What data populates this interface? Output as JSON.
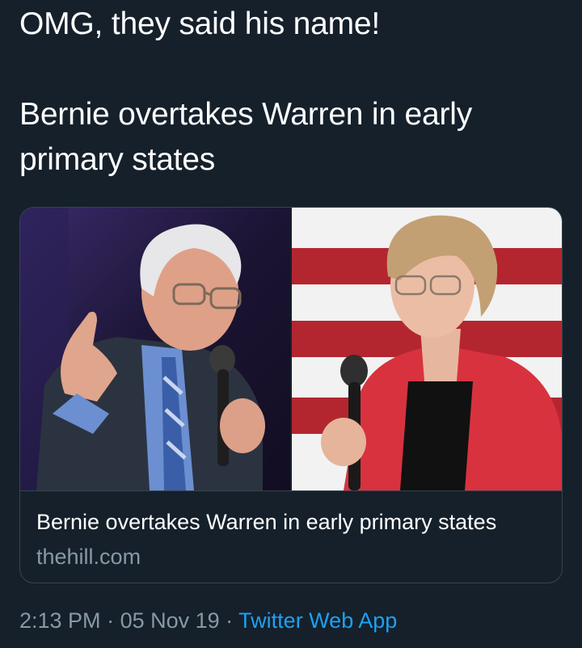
{
  "tweet": {
    "line1": "OMG, they said his name!",
    "line2": "Bernie overtakes Warren in early",
    "line3": "primary states"
  },
  "card": {
    "title": "Bernie overtakes Warren in early primary states",
    "domain": "thehill.com",
    "image": {
      "left_photo": "bernie-sanders-with-microphone",
      "right_photo": "elizabeth-warren-with-microphone",
      "colors": {
        "left_background": "#231a3d",
        "flag_red": "#b4262f",
        "flag_white": "#f2f2f2",
        "jacket_red": "#d8323f",
        "suit_dark": "#2b3340"
      }
    }
  },
  "meta": {
    "time": "2:13 PM",
    "separator": " · ",
    "date": "05 Nov 19",
    "source": "Twitter Web App"
  },
  "colors": {
    "background": "#15202b",
    "text": "#ffffff",
    "secondary": "#8899a6",
    "link": "#1da1f2",
    "border": "#38444d"
  }
}
